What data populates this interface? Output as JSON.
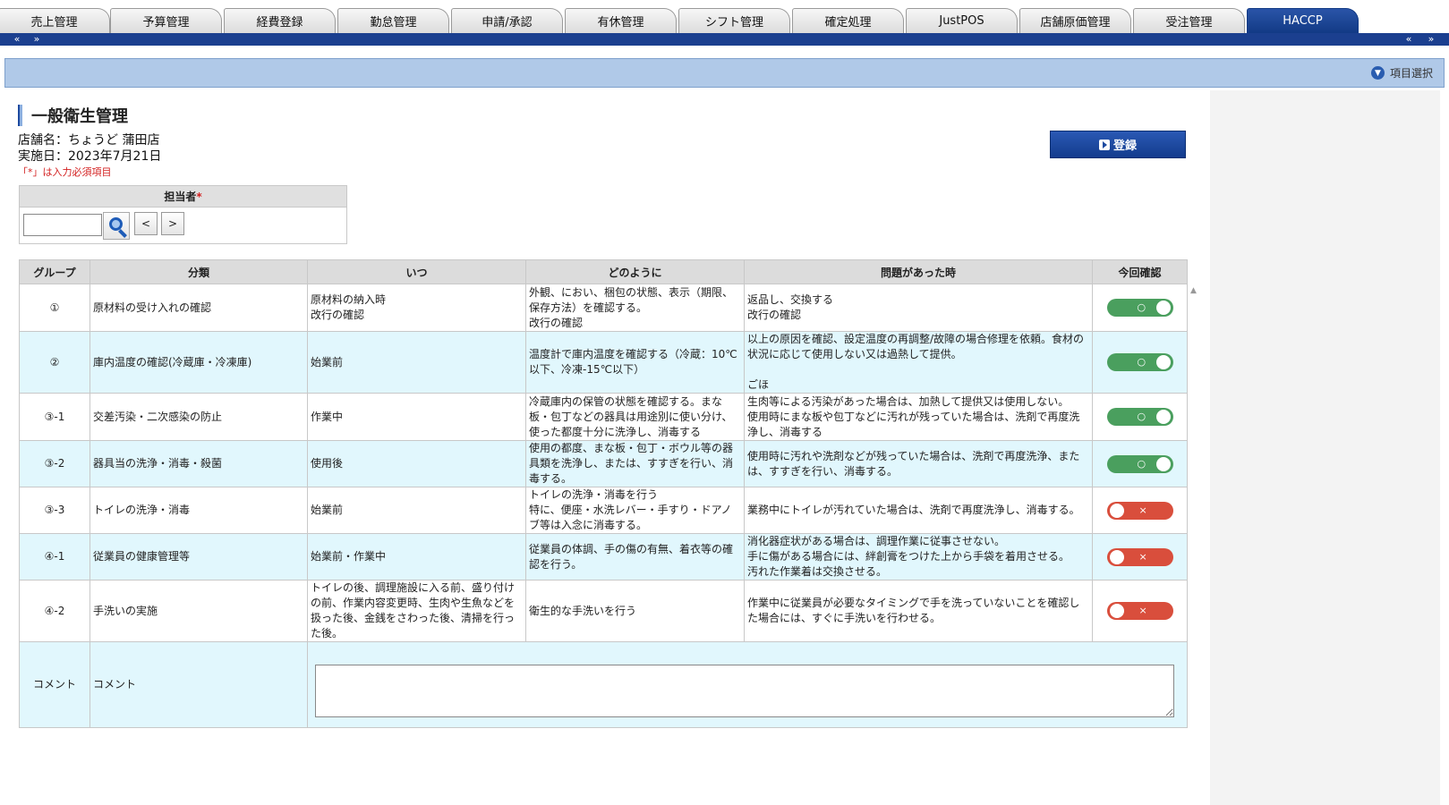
{
  "tabs": [
    "売上管理",
    "予算管理",
    "経費登録",
    "勤怠管理",
    "申請/承認",
    "有休管理",
    "シフト管理",
    "確定処理",
    "JustPOS",
    "店舗原価管理",
    "受注管理",
    "HACCP"
  ],
  "nav": {
    "prev": "«",
    "next": "»"
  },
  "select_bar": {
    "label": "項目選択",
    "icon": "chevron-down-icon"
  },
  "page": {
    "title": "一般衛生管理",
    "store": "店舗名：ちょうど 蒲田店",
    "date": "実施日：2023年7月21日",
    "required_note": "「*」は入力必須項目"
  },
  "register_button": "登録",
  "assignee": {
    "label": "担当者",
    "required_mark": "*",
    "value": "",
    "prev": "<",
    "next": ">"
  },
  "table": {
    "headers": [
      "グループ",
      "分類",
      "いつ",
      "どのように",
      "問題があった時",
      "今回確認"
    ],
    "rows": [
      {
        "group": "①",
        "category": "原材料の受け入れの確認",
        "when": "原材料の納入時\n改行の確認",
        "how": "外観、におい、梱包の状態、表示（期限、保存方法）を確認する。\n改行の確認",
        "problem": "返品し、交換する\n改行の確認",
        "status": "on",
        "mark": "○"
      },
      {
        "group": "②",
        "category": "庫内温度の確認(冷蔵庫・冷凍庫)",
        "when": "始業前",
        "how": "温度計で庫内温度を確認する（冷蔵：10℃以下、冷凍-15℃以下）",
        "problem": "以上の原因を確認、設定温度の再調整/故障の場合修理を依頼。食材の状況に応じて使用しない又は過熱して提供。\n\nごほ",
        "status": "on",
        "mark": "○"
      },
      {
        "group": "③-1",
        "category": "交差汚染・二次感染の防止",
        "when": "作業中",
        "how": "冷蔵庫内の保管の状態を確認する。まな板・包丁などの器具は用途別に使い分け、使った都度十分に洗浄し、消毒する",
        "problem": "生肉等による汚染があった場合は、加熱して提供又は使用しない。\n使用時にまな板や包丁などに汚れが残っていた場合は、洗剤で再度洗浄し、消毒する",
        "status": "on",
        "mark": "○"
      },
      {
        "group": "③-2",
        "category": "器具当の洗浄・消毒・殺菌",
        "when": "使用後",
        "how": "使用の都度、まな板・包丁・ボウル等の器具類を洗浄し、または、すすぎを行い、消毒する。",
        "problem": "使用時に汚れや洗剤などが残っていた場合は、洗剤で再度洗浄、または、すすぎを行い、消毒する。",
        "status": "on",
        "mark": "○"
      },
      {
        "group": "③-3",
        "category": "トイレの洗浄・消毒",
        "when": "始業前",
        "how": "トイレの洗浄・消毒を行う\n特に、便座・水洗レバー・手すり・ドアノブ等は入念に消毒する。",
        "problem": "業務中にトイレが汚れていた場合は、洗剤で再度洗浄し、消毒する。",
        "status": "off",
        "mark": "×"
      },
      {
        "group": "④-1",
        "category": "従業員の健康管理等",
        "when": "始業前・作業中",
        "how": "従業員の体調、手の傷の有無、着衣等の確認を行う。",
        "problem": "消化器症状がある場合は、調理作業に従事させない。\n手に傷がある場合には、絆創膏をつけた上から手袋を着用させる。\n汚れた作業着は交換させる。",
        "status": "off",
        "mark": "×"
      },
      {
        "group": "④-2",
        "category": "手洗いの実施",
        "when": "トイレの後、調理施設に入る前、盛り付けの前、作業内容変更時、生肉や生魚などを扱った後、金銭をさわった後、清掃を行った後。",
        "how": "衛生的な手洗いを行う",
        "problem": "作業中に従業員が必要なタイミングで手を洗っていないことを確認した場合には、すぐに手洗いを行わせる。",
        "status": "off",
        "mark": "×"
      }
    ],
    "comment": {
      "group": "コメント",
      "category": "コメント",
      "value": ""
    }
  }
}
